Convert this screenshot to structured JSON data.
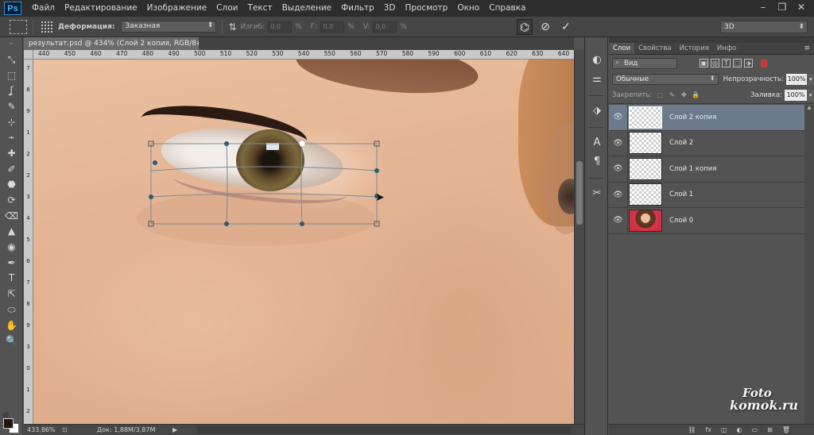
{
  "app": {
    "logo": "Ps"
  },
  "menu": [
    "Файл",
    "Редактирование",
    "Изображение",
    "Слои",
    "Текст",
    "Выделение",
    "Фильтр",
    "3D",
    "Просмотр",
    "Окно",
    "Справка"
  ],
  "window_controls": [
    "–",
    "❐",
    "✕"
  ],
  "options": {
    "warp_label": "Деформация:",
    "warp_value": "Заказная",
    "bend_label": "Изгиб:",
    "bend_value": "0,0",
    "h_label": "Г:",
    "h_value": "0,0",
    "v_label": "V:",
    "v_value": "0,0",
    "unit": "%",
    "workspace": "3D"
  },
  "document": {
    "tab_title": "результат.psd @ 434% (Слой 2 копия, RGB/8#) *",
    "close": "×",
    "ruler_h_ticks": [
      "440",
      "450",
      "460",
      "470",
      "480",
      "490",
      "500",
      "510",
      "520",
      "530",
      "540",
      "550",
      "560",
      "570",
      "580",
      "590",
      "600",
      "610",
      "620",
      "630",
      "640"
    ],
    "ruler_v_ticks": [
      "7",
      "8",
      "9",
      "1",
      "2",
      "2",
      "3",
      "4",
      "5",
      "6",
      "7",
      "8",
      "9",
      "3",
      "0",
      "1",
      "2"
    ]
  },
  "status": {
    "zoom": "433,86%",
    "doc": "Док: 1,88М/3,87М",
    "arrow": "▶"
  },
  "tools": [
    "⤡",
    "⬚",
    "ʆ",
    "✎",
    "⊹",
    "⌁",
    "✚",
    "✐",
    "⬣",
    "⟳",
    "⌫",
    "▲",
    "◉",
    "✒",
    "T",
    "⇱",
    "⬭",
    "✋",
    "🔍"
  ],
  "dock_icons": [
    "◐",
    "⚌",
    "⬗",
    "A",
    "¶",
    "✂"
  ],
  "layers_panel": {
    "tabs": [
      "Слои",
      "Свойства",
      "История",
      "Инфо"
    ],
    "menu": "≡",
    "kind": "Вид",
    "filters": [
      "▣",
      "◎",
      "T",
      "⬚",
      "⬗"
    ],
    "blend": "Обычные",
    "opacity_label": "Непрозрачность:",
    "opacity": "100%",
    "lock_label": "Закрепить:",
    "lock_icons": [
      "⬚",
      "✎",
      "✥",
      "🔒"
    ],
    "fill_label": "Заливка:",
    "fill": "100%",
    "layers": [
      {
        "name": "Слой 2 копия",
        "selected": true,
        "thumb": "transparent"
      },
      {
        "name": "Слой 2",
        "selected": false,
        "thumb": "transparent"
      },
      {
        "name": "Слой 1 копия",
        "selected": false,
        "thumb": "transparent"
      },
      {
        "name": "Слой 1",
        "selected": false,
        "thumb": "transparent"
      },
      {
        "name": "Слой 0",
        "selected": false,
        "thumb": "photo"
      }
    ],
    "bottom_icons": [
      "⛓",
      "fx",
      "◫",
      "◐",
      "▭",
      "⊞",
      "🗑"
    ]
  },
  "watermark": {
    "line1": "Foto",
    "line2": "komok.ru"
  }
}
